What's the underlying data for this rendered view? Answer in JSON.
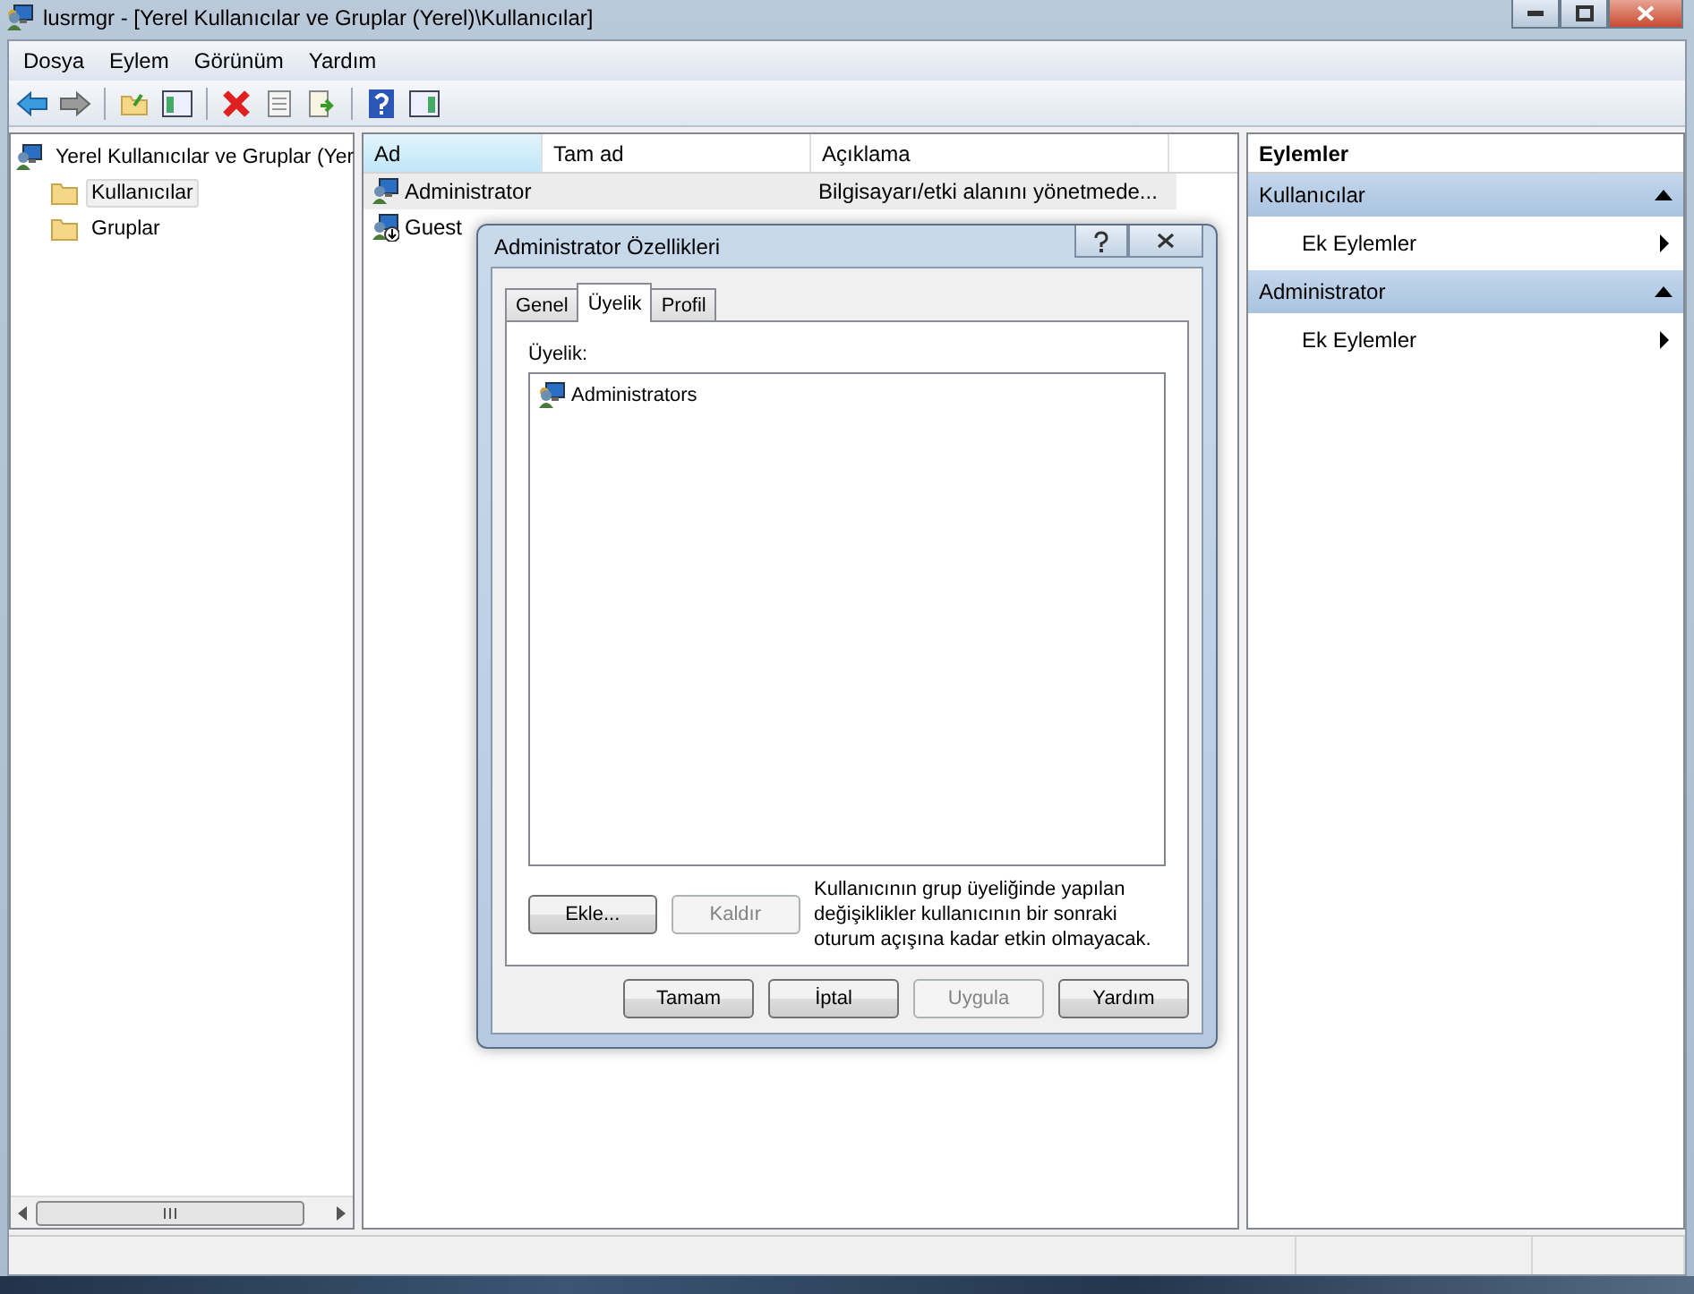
{
  "window": {
    "title": "lusrmgr - [Yerel Kullanıcılar ve Gruplar (Yerel)\\Kullanıcılar]"
  },
  "menu": [
    "Dosya",
    "Eylem",
    "Görünüm",
    "Yardım"
  ],
  "tree": {
    "label": "Yerel Kullanıcılar ve Gruplar (Yer",
    "children": [
      {
        "label": "Kullanıcılar",
        "selected": true
      },
      {
        "label": "Gruplar",
        "selected": false
      }
    ]
  },
  "list": {
    "columns": [
      {
        "label": "Ad",
        "sorted": true
      },
      {
        "label": "Tam ad",
        "sorted": false
      },
      {
        "label": "Açıklama",
        "sorted": false
      }
    ],
    "rows": [
      {
        "name": "Administrator",
        "kind": "admin",
        "description": "Bilgisayarı/etki alanını yönetmede...",
        "selected": true
      },
      {
        "name": "Guest",
        "kind": "guest",
        "selected": false
      }
    ]
  },
  "actions": {
    "title": "Eylemler",
    "sections": [
      {
        "title": "Kullanıcılar",
        "items": [
          "Ek Eylemler"
        ]
      },
      {
        "title": "Administrator",
        "items": [
          "Ek Eylemler"
        ]
      }
    ]
  },
  "dialog": {
    "title": "Administrator Özellikleri",
    "tabs": [
      {
        "label": "Genel",
        "selected": false
      },
      {
        "label": "Üyelik",
        "selected": true
      },
      {
        "label": "Profil",
        "selected": false
      }
    ],
    "members_label": "Üyelik:",
    "members": [
      "Administrators"
    ],
    "member_buttons": [
      {
        "label": "Ekle...",
        "disabled": false
      },
      {
        "label": "Kaldır",
        "disabled": true
      }
    ],
    "note": "Kullanıcının grup üyeliğinde yapılan değişiklikler kullanıcının bir sonraki oturum açışına kadar etkin olmayacak.",
    "buttons": [
      {
        "label": "Tamam",
        "disabled": false
      },
      {
        "label": "İptal",
        "disabled": false
      },
      {
        "label": "Uygula",
        "disabled": true
      },
      {
        "label": "Yardım",
        "disabled": false
      }
    ]
  }
}
